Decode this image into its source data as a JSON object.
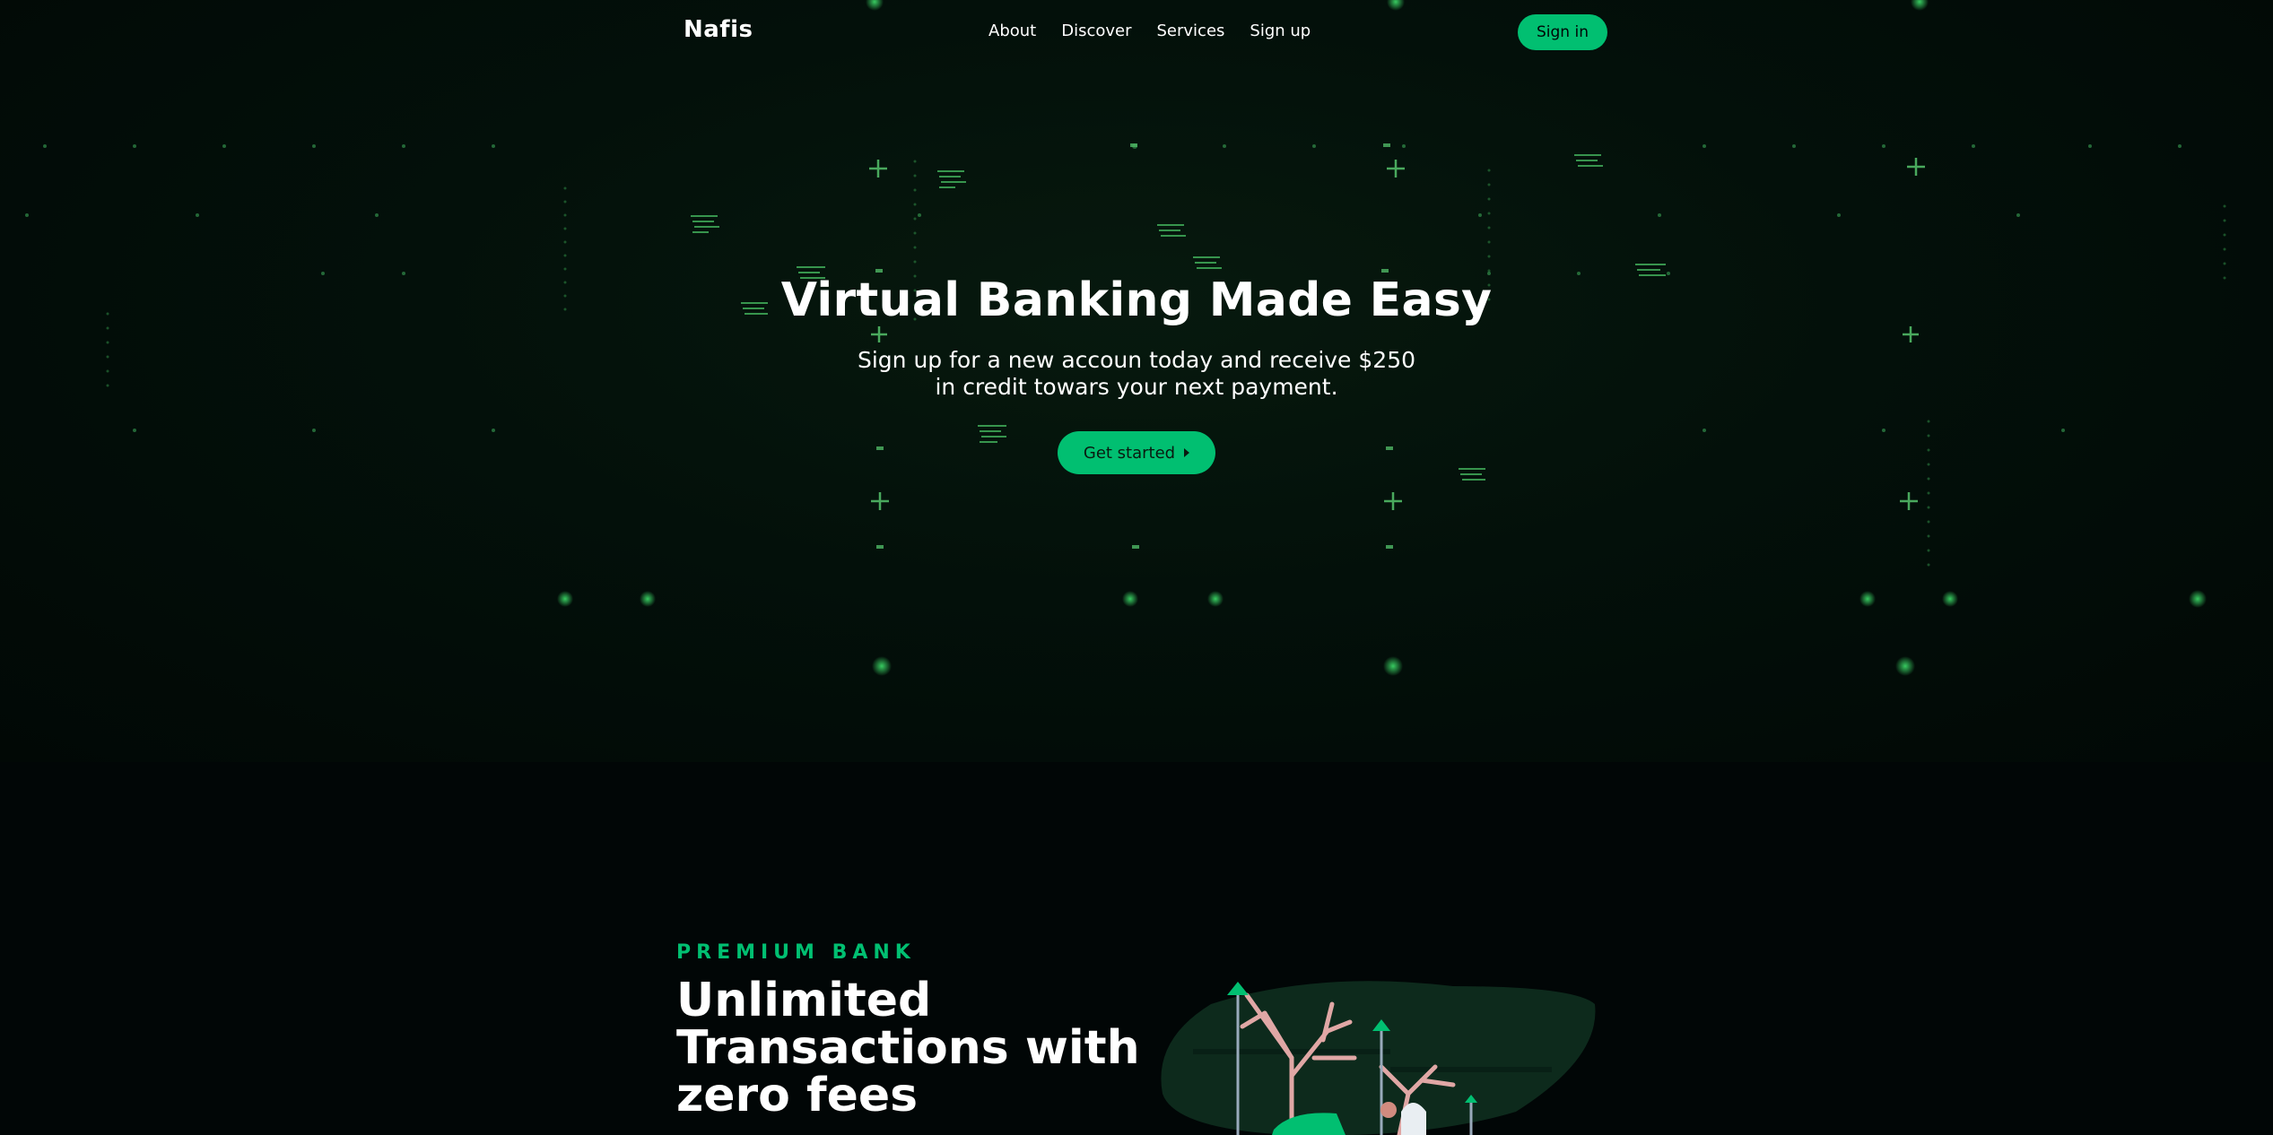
{
  "nav": {
    "logo": "Nafis",
    "links": [
      "About",
      "Discover",
      "Services",
      "Sign up"
    ],
    "signin_label": "Sign in"
  },
  "hero": {
    "title": "Virtual Banking Made Easy",
    "subtitle": "Sign up for a new accoun today and receive $250 in credit towars your next payment.",
    "cta_label": "Get started",
    "cta_icon": "caret-right-icon"
  },
  "section": {
    "eyebrow": "PREMIUM BANK",
    "title": "Unlimited Transactions with zero fees"
  },
  "colors": {
    "accent": "#01bf71",
    "background": "#010606",
    "text": "#ffffff"
  }
}
